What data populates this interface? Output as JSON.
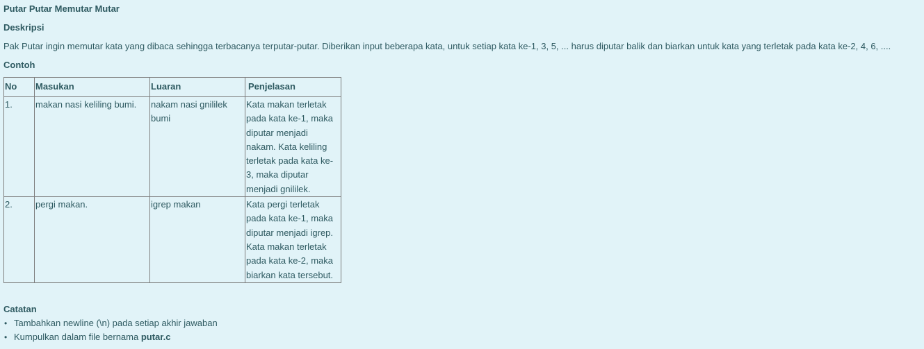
{
  "title": "Putar Putar Memutar Mutar",
  "description": {
    "heading": "Deskripsi",
    "text": "Pak Putar ingin memutar kata yang dibaca sehingga terbacanya terputar-putar. Diberikan input beberapa kata, untuk setiap kata ke-1, 3, 5, ... harus diputar balik dan biarkan untuk kata yang terletak pada kata ke-2, 4, 6, ...."
  },
  "example": {
    "heading": "Contoh",
    "columns": [
      "No",
      "Masukan",
      "Luaran",
      "Penjelasan"
    ],
    "rows": [
      {
        "no": "1.",
        "input": "makan nasi keliling bumi.",
        "output": "nakam nasi gnililek bumi",
        "explanation": "Kata makan terletak pada kata ke-1, maka diputar menjadi nakam. Kata keliling terletak pada kata ke-3, maka diputar menjadi gnililek."
      },
      {
        "no": "2.",
        "input": "pergi makan.",
        "output": "igrep makan",
        "explanation": "Kata pergi terletak pada kata ke-1, maka diputar menjadi igrep. Kata makan terletak pada kata ke-2, maka biarkan kata tersebut."
      }
    ]
  },
  "notes": {
    "heading": "Catatan",
    "items": [
      {
        "text": "Tambahkan newline (\\n) pada setiap akhir jawaban",
        "bold": ""
      },
      {
        "text": "Kumpulkan dalam file bernama ",
        "bold": "putar.c"
      }
    ]
  },
  "colors": {
    "background": "#e1f3f8",
    "text": "#2e5a61",
    "border": "#7d7d7d"
  }
}
